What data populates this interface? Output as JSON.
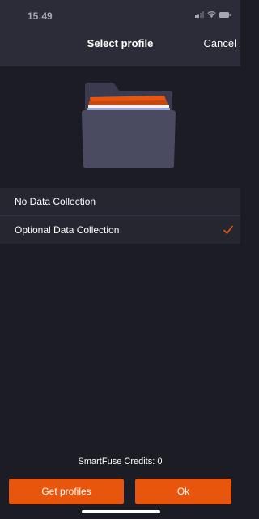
{
  "colors": {
    "background": "#1c1c25",
    "header": "#2c2c38",
    "list_row": "#262630",
    "accent": "#e8560e",
    "folder_body": "#4a4a61",
    "folder_tab": "#3b3b50"
  },
  "status_bar": {
    "time": "15:49",
    "icons": [
      "signal-icon",
      "wifi-icon",
      "battery-icon"
    ]
  },
  "header": {
    "title": "Select profile",
    "cancel_label": "Cancel"
  },
  "illustration": {
    "icon": "open-folder-icon"
  },
  "profiles": [
    {
      "label": "No Data Collection",
      "selected": false
    },
    {
      "label": "Optional Data Collection",
      "selected": true
    }
  ],
  "footer": {
    "credits": "SmartFuse Credits: 0",
    "get_profiles_label": "Get profiles",
    "ok_label": "Ok"
  }
}
